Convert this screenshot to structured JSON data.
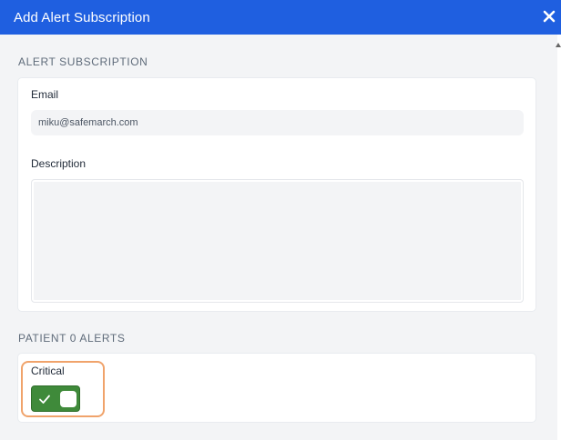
{
  "dialog": {
    "title": "Add Alert Subscription"
  },
  "alert_subscription": {
    "heading": "ALERT SUBSCRIPTION",
    "email_label": "Email",
    "email_value": "miku@safemarch.com",
    "description_label": "Description",
    "description_value": ""
  },
  "patient_alerts": {
    "heading": "PATIENT 0 ALERTS",
    "critical_label": "Critical",
    "critical_enabled": true
  },
  "icons": {
    "close": "close-icon",
    "check": "check-icon"
  },
  "colors": {
    "titlebar": "#1f5fe0",
    "toggle_on": "#3f8a3a",
    "highlight": "#f0a36b"
  }
}
